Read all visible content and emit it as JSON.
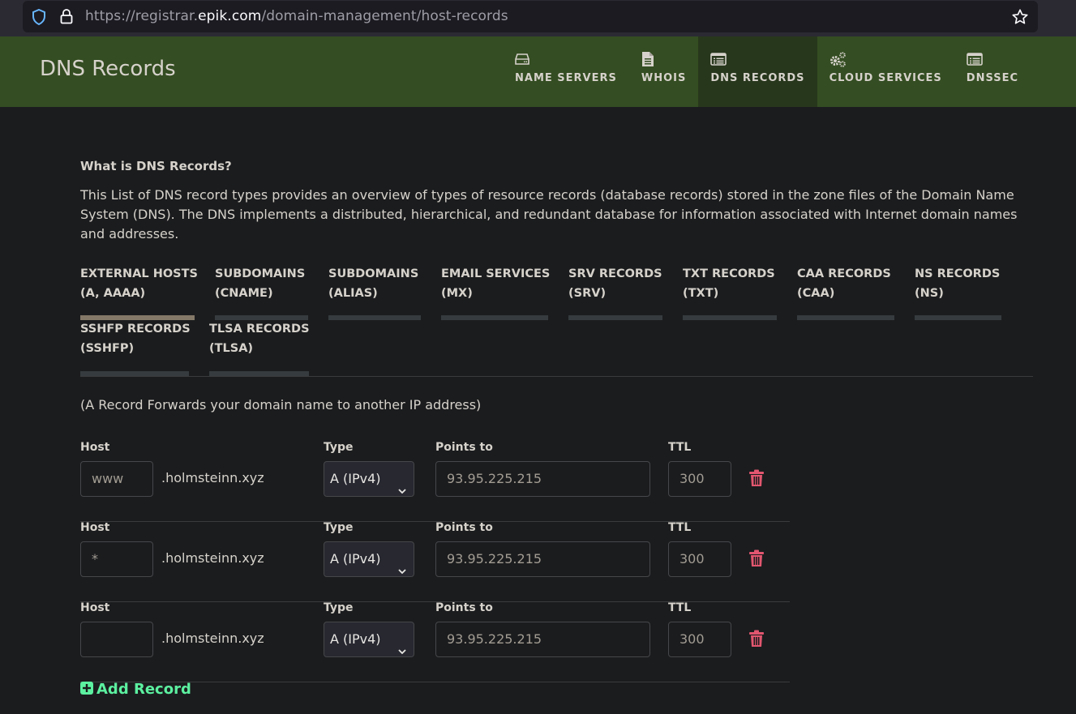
{
  "browser": {
    "url_prefix": "https://registrar.",
    "url_host": "epik.com",
    "url_path": "/domain-management/host-records",
    "icons": [
      "shield-icon",
      "lock-icon",
      "star-icon"
    ]
  },
  "header": {
    "title": "DNS Records",
    "nav": [
      {
        "label": "NAME SERVERS",
        "icon": "hard-drive-icon",
        "active": false
      },
      {
        "label": "WHOIS",
        "icon": "document-icon",
        "active": false
      },
      {
        "label": "DNS RECORDS",
        "icon": "list-window-icon",
        "active": true
      },
      {
        "label": "CLOUD SERVICES",
        "icon": "gears-icon",
        "active": false
      },
      {
        "label": "DNSSEC",
        "icon": "list-window-icon",
        "active": false
      }
    ]
  },
  "intro": {
    "title": "What is DNS Records?",
    "description": "This List of DNS record types provides an overview of types of resource records (database records) stored in the zone files of the Domain Name System (DNS). The DNS implements a distributed, hierarchical, and redundant database for information associated with Internet domain names and addresses."
  },
  "record_tabs": [
    {
      "line1": "EXTERNAL HOSTS",
      "line2": "(A, AAAA)",
      "active": true
    },
    {
      "line1": "SUBDOMAINS",
      "line2": "(CNAME)",
      "active": false
    },
    {
      "line1": "SUBDOMAINS",
      "line2": "(ALIAS)",
      "active": false
    },
    {
      "line1": "EMAIL SERVICES",
      "line2": "(MX)",
      "active": false
    },
    {
      "line1": "SRV RECORDS",
      "line2": "(SRV)",
      "active": false
    },
    {
      "line1": "TXT RECORDS",
      "line2": "(TXT)",
      "active": false
    },
    {
      "line1": "CAA RECORDS",
      "line2": "(CAA)",
      "active": false
    },
    {
      "line1": "NS RECORDS",
      "line2": "(NS)",
      "active": false
    },
    {
      "line1": "SSHFP RECORDS",
      "line2": "(SSHFP)",
      "active": false
    },
    {
      "line1": "TLSA RECORDS",
      "line2": "(TLSA)",
      "active": false
    }
  ],
  "note": "(A Record Forwards your domain name to another IP address)",
  "labels": {
    "host": "Host",
    "type": "Type",
    "points_to": "Points to",
    "ttl": "TTL"
  },
  "records": [
    {
      "host": "www",
      "domain_suffix": ".holmsteinn.xyz",
      "type": "A (IPv4)",
      "points_to": "93.95.225.215",
      "ttl": "300"
    },
    {
      "host": "*",
      "domain_suffix": ".holmsteinn.xyz",
      "type": "A (IPv4)",
      "points_to": "93.95.225.215",
      "ttl": "300"
    },
    {
      "host": "",
      "domain_suffix": ".holmsteinn.xyz",
      "type": "A (IPv4)",
      "points_to": "93.95.225.215",
      "ttl": "300"
    }
  ],
  "add_record_label": "Add Record",
  "colors": {
    "header_bg": "#344d22",
    "nav_active_bg": "#27371c",
    "page_bg": "#1b1c1e",
    "tab_active_bar": "#847868",
    "tab_bar": "#353b3e",
    "delete_icon": "#e2566f",
    "add_record": "#5cf0a0"
  }
}
